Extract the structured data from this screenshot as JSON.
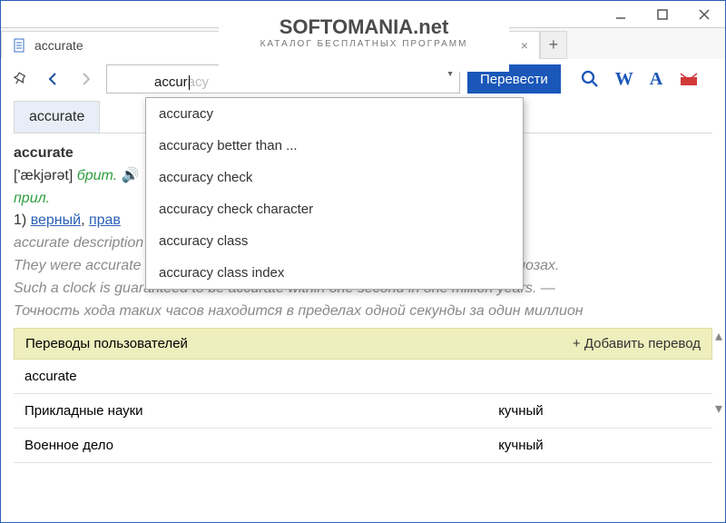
{
  "window": {
    "tab_title": "accurate",
    "watermark_big": "SOFTOMANIA.net",
    "watermark_sub": "КАТАЛОГ БЕСПЛАТНЫХ ПРОГРАММ"
  },
  "toolbar": {
    "search_ghost": "accuracy",
    "search_typed": "accur",
    "translate_label": "Перевести"
  },
  "suggestions": [
    "accuracy",
    "accuracy better than ...",
    "accuracy check",
    "accuracy check character",
    "accuracy class",
    "accuracy class index"
  ],
  "entry": {
    "tab_label": "accurate",
    "headword": "accurate",
    "ipa": "['ækjərət]",
    "variant": "брит.",
    "pos": "прил.",
    "def_number": "1)",
    "def_link1": "верный",
    "def_sep": ", ",
    "def_link2": "прав",
    "desc_line": "accurate description — точное описание",
    "ex1": "They were accurate in their prediction. — Они оказались правы в своих прогнозах.",
    "ex2": "Such a clock is guaranteed to be accurate within one second in one million years. —",
    "ex3": "Точность хода таких часов находится в пределах одной секунды за один миллион"
  },
  "user_translations": {
    "header": "Переводы пользователей",
    "add_label": "+  Добавить перевод",
    "word": "accurate",
    "rows": [
      {
        "domain": "Прикладные науки",
        "translation": "кучный"
      },
      {
        "domain": "Военное дело",
        "translation": "кучный"
      }
    ]
  }
}
